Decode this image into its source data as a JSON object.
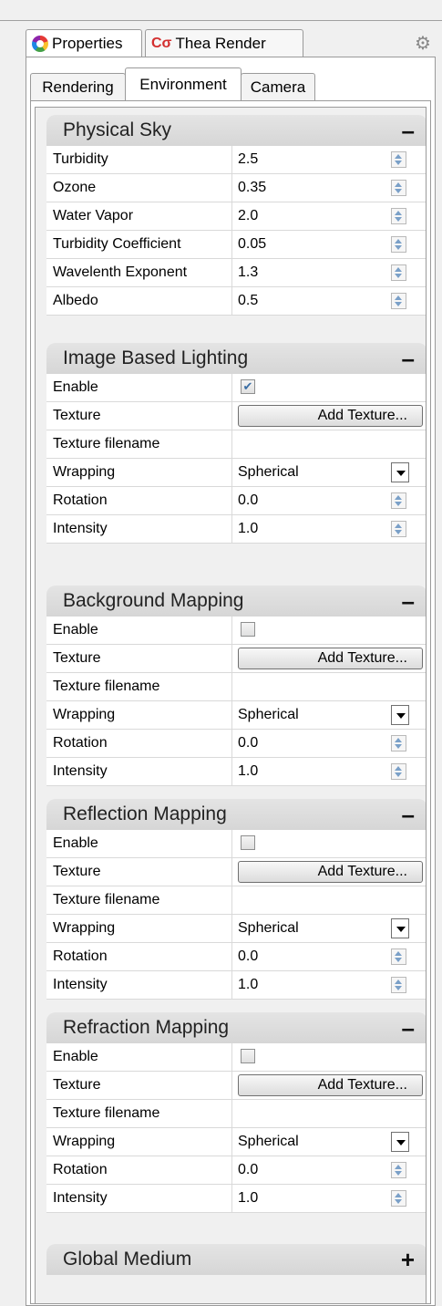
{
  "main_tabs": [
    {
      "label": "Properties",
      "icon": "properties-icon"
    },
    {
      "label": "Thea Render",
      "icon": "thea-render-icon"
    }
  ],
  "sub_tabs": [
    "Rendering",
    "Environment",
    "Camera"
  ],
  "settings_icon": "gear-icon",
  "sections": [
    {
      "title": "Physical Sky",
      "toggle": "–",
      "rows": [
        {
          "label": "Turbidity",
          "value": "2.5"
        },
        {
          "label": "Ozone",
          "value": "0.35"
        },
        {
          "label": "Water Vapor",
          "value": "2.0"
        },
        {
          "label": "Turbidity Coefficient",
          "value": "0.05"
        },
        {
          "label": "Wavelenth Exponent",
          "value": "1.3"
        },
        {
          "label": "Albedo",
          "value": "0.5"
        }
      ]
    },
    {
      "title": "Image Based Lighting",
      "toggle": "–",
      "enable_label": "Enable",
      "enabled": true,
      "texture_label": "Texture",
      "texture_button": "Add Texture...",
      "filename_label": "Texture filename",
      "filename": "",
      "wrapping_label": "Wrapping",
      "wrapping": "Spherical",
      "rotation_label": "Rotation",
      "rotation": "0.0",
      "intensity_label": "Intensity",
      "intensity": "1.0"
    },
    {
      "title": "Background Mapping",
      "toggle": "–",
      "enable_label": "Enable",
      "enabled": false,
      "texture_label": "Texture",
      "texture_button": "Add Texture...",
      "filename_label": "Texture filename",
      "filename": "",
      "wrapping_label": "Wrapping",
      "wrapping": "Spherical",
      "rotation_label": "Rotation",
      "rotation": "0.0",
      "intensity_label": "Intensity",
      "intensity": "1.0"
    },
    {
      "title": "Reflection Mapping",
      "toggle": "–",
      "enable_label": "Enable",
      "enabled": false,
      "texture_label": "Texture",
      "texture_button": "Add Texture...",
      "filename_label": "Texture filename",
      "filename": "",
      "wrapping_label": "Wrapping",
      "wrapping": "Spherical",
      "rotation_label": "Rotation",
      "rotation": "0.0",
      "intensity_label": "Intensity",
      "intensity": "1.0"
    },
    {
      "title": "Refraction Mapping",
      "toggle": "–",
      "enable_label": "Enable",
      "enabled": false,
      "texture_label": "Texture",
      "texture_button": "Add Texture...",
      "filename_label": "Texture filename",
      "filename": "",
      "wrapping_label": "Wrapping",
      "wrapping": "Spherical",
      "rotation_label": "Rotation",
      "rotation": "0.0",
      "intensity_label": "Intensity",
      "intensity": "1.0"
    },
    {
      "title": "Global Medium",
      "toggle": "+"
    }
  ]
}
